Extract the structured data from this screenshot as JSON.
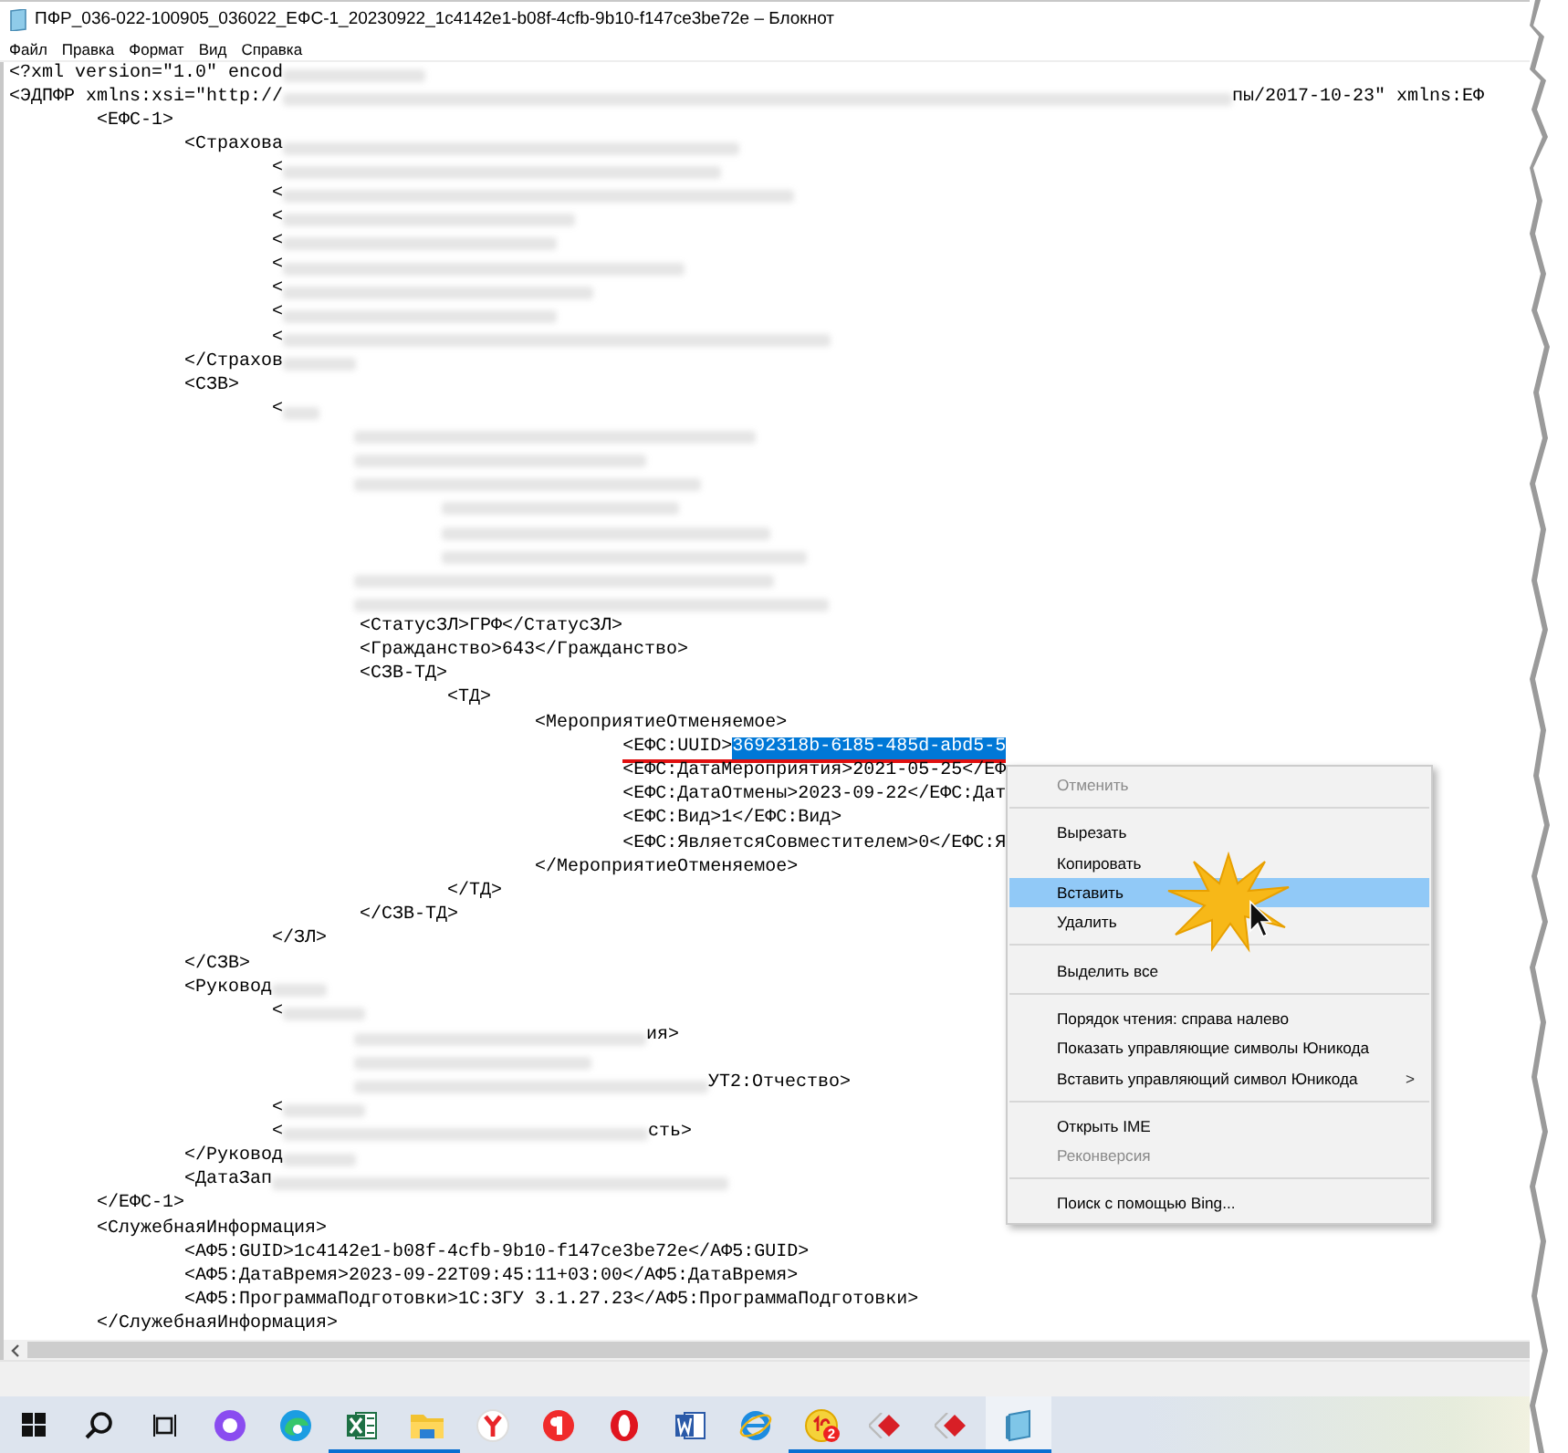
{
  "window": {
    "title": "ПФР_036-022-100905_036022_ЕФС-1_20230922_1c4142e1-b08f-4cfb-9b10-f147ce3be72e – Блокнот"
  },
  "menu": [
    "Файл",
    "Правка",
    "Формат",
    "Вид",
    "Справка"
  ],
  "lines": [
    {
      "text": "<?xml version=\"1.0\" encod",
      "redacted": true
    },
    {
      "text": "<ЭДПФР xmlns:xsi=\"http://",
      "redacted": true,
      "tail": "пы/2017-10-23\" xmlns:ЕФ"
    },
    {
      "text": "\t<ЕФС-1>"
    },
    {
      "text": "\t\t<Страхова",
      "redacted": true
    },
    {
      "text": "\t\t\t<",
      "redacted": true
    },
    {
      "text": "\t\t\t<",
      "redacted": true
    },
    {
      "text": "\t\t\t<",
      "redacted": true
    },
    {
      "text": "\t\t\t<",
      "redacted": true
    },
    {
      "text": "\t\t\t<",
      "redacted": true
    },
    {
      "text": "\t\t\t<",
      "redacted": true
    },
    {
      "text": "\t\t\t<",
      "redacted": true
    },
    {
      "text": "\t\t\t<",
      "redacted": true
    },
    {
      "text": "\t\t</Страхов",
      "redacted": true
    },
    {
      "text": "\t\t<СЗВ>"
    },
    {
      "text": "\t\t\t<",
      "redacted": true
    },
    {
      "redacted": true
    },
    {
      "redacted": true
    },
    {
      "redacted": true
    },
    {
      "redacted": true
    },
    {
      "redacted": true
    },
    {
      "redacted": true
    },
    {
      "redacted": true
    },
    {
      "redacted": true
    },
    {
      "text": "\t\t\t\t<СтатусЗЛ>ГРФ</СтатусЗЛ>"
    },
    {
      "text": "\t\t\t\t<Гражданство>643</Гражданство>"
    },
    {
      "text": "\t\t\t\t<СЗВ-ТД>"
    },
    {
      "text": "\t\t\t\t\t<ТД>"
    },
    {
      "text": "\t\t\t\t\t\t<МероприятиеОтменяемое>"
    },
    {
      "text": "\t\t\t\t\t\t\t<ЕФС:UUID>",
      "selected_text": "3692318b-6185-485d-abd5-5",
      "underlined": true
    },
    {
      "text": "\t\t\t\t\t\t\t<ЕФС:ДатаМероприятия>2021-05-25</ЕФ"
    },
    {
      "text": "\t\t\t\t\t\t\t<ЕФС:ДатаОтмены>2023-09-22</ЕФС:Дат"
    },
    {
      "text": "\t\t\t\t\t\t\t<ЕФС:Вид>1</ЕФС:Вид>"
    },
    {
      "text": "\t\t\t\t\t\t\t<ЕФС:ЯвляетсяСовместителем>0</ЕФС:Я"
    },
    {
      "text": "\t\t\t\t\t\t</МероприятиеОтменяемое>"
    },
    {
      "text": "\t\t\t\t\t</ТД>"
    },
    {
      "text": "\t\t\t\t</СЗВ-ТД>"
    },
    {
      "text": "\t\t\t</ЗЛ>"
    },
    {
      "text": "\t\t</СЗВ>"
    },
    {
      "text": "\t\t<Руковод",
      "redacted": true
    },
    {
      "text": "\t\t\t<",
      "redacted": true
    },
    {
      "redacted": true,
      "tail": "ия>"
    },
    {
      "redacted": true
    },
    {
      "redacted": true,
      "tail": "УТ2:Отчество>"
    },
    {
      "text": "\t\t\t<",
      "redacted": true
    },
    {
      "text": "\t\t\t<",
      "redacted": true,
      "tail": "сть>"
    },
    {
      "text": "\t\t</Руковод",
      "redacted": true
    },
    {
      "text": "\t\t<ДатаЗап",
      "redacted": true
    },
    {
      "text": "\t</ЕФС-1>"
    },
    {
      "text": "\t<СлужебнаяИнформация>"
    },
    {
      "text": "\t\t<АФ5:GUID>1c4142e1-b08f-4cfb-9b10-f147ce3be72e</АФ5:GUID>"
    },
    {
      "text": "\t\t<АФ5:ДатаВремя>2023-09-22T09:45:11+03:00</АФ5:ДатаВремя>"
    },
    {
      "text": "\t\t<АФ5:ПрограммаПодготовки>1С:ЗГУ 3.1.27.23</АФ5:ПрограммаПодготовки>"
    },
    {
      "text": "\t</СлужебнаяИнформация>"
    }
  ],
  "context_menu": [
    {
      "kind": "item",
      "label": "Отменить",
      "disabled": true,
      "selected": false
    },
    {
      "kind": "separator"
    },
    {
      "kind": "item",
      "label": "Вырезать",
      "disabled": false,
      "selected": false
    },
    {
      "kind": "item",
      "label": "Копировать",
      "disabled": false,
      "selected": false
    },
    {
      "kind": "item",
      "label": "Вставить",
      "disabled": false,
      "selected": true
    },
    {
      "kind": "item",
      "label": "Удалить",
      "disabled": false,
      "selected": false
    },
    {
      "kind": "separator"
    },
    {
      "kind": "item",
      "label": "Выделить все",
      "disabled": false,
      "selected": false
    },
    {
      "kind": "separator"
    },
    {
      "kind": "item",
      "label": "Порядок чтения: справа налево",
      "disabled": false,
      "selected": false
    },
    {
      "kind": "item",
      "label": "Показать управляющие символы Юникода",
      "disabled": false,
      "selected": false
    },
    {
      "kind": "item",
      "label": "Вставить управляющий символ Юникода",
      "disabled": false,
      "selected": false,
      "submenu": ">"
    },
    {
      "kind": "separator"
    },
    {
      "kind": "item",
      "label": "Открыть IME",
      "disabled": false,
      "selected": false
    },
    {
      "kind": "item",
      "label": "Реконверсия",
      "disabled": true,
      "selected": false
    },
    {
      "kind": "separator"
    },
    {
      "kind": "item",
      "label": "Поиск с помощью Bing...",
      "disabled": false,
      "selected": false
    }
  ],
  "taskbar": [
    {
      "kind": "start",
      "running": false,
      "selected": false
    },
    {
      "kind": "search",
      "running": false,
      "selected": false
    },
    {
      "kind": "taskview",
      "running": false,
      "selected": false
    },
    {
      "kind": "ring",
      "running": false,
      "selected": false
    },
    {
      "kind": "swirl",
      "running": false,
      "selected": false
    },
    {
      "kind": "spreadsheet",
      "running": true,
      "selected": false
    },
    {
      "kind": "folder",
      "running": true,
      "selected": false
    },
    {
      "kind": "browser",
      "running": false,
      "selected": false
    },
    {
      "kind": "round",
      "running": false,
      "selected": false
    },
    {
      "kind": "oring",
      "running": false,
      "selected": false
    },
    {
      "kind": "document",
      "running": false,
      "selected": false
    },
    {
      "kind": "globe",
      "running": false,
      "selected": false
    },
    {
      "kind": "coin",
      "running": true,
      "selected": false,
      "badge": "2"
    },
    {
      "kind": "diamond",
      "running": true,
      "selected": false
    },
    {
      "kind": "diamond",
      "running": true,
      "selected": false
    },
    {
      "kind": "notepad",
      "running": true,
      "selected": true
    }
  ]
}
